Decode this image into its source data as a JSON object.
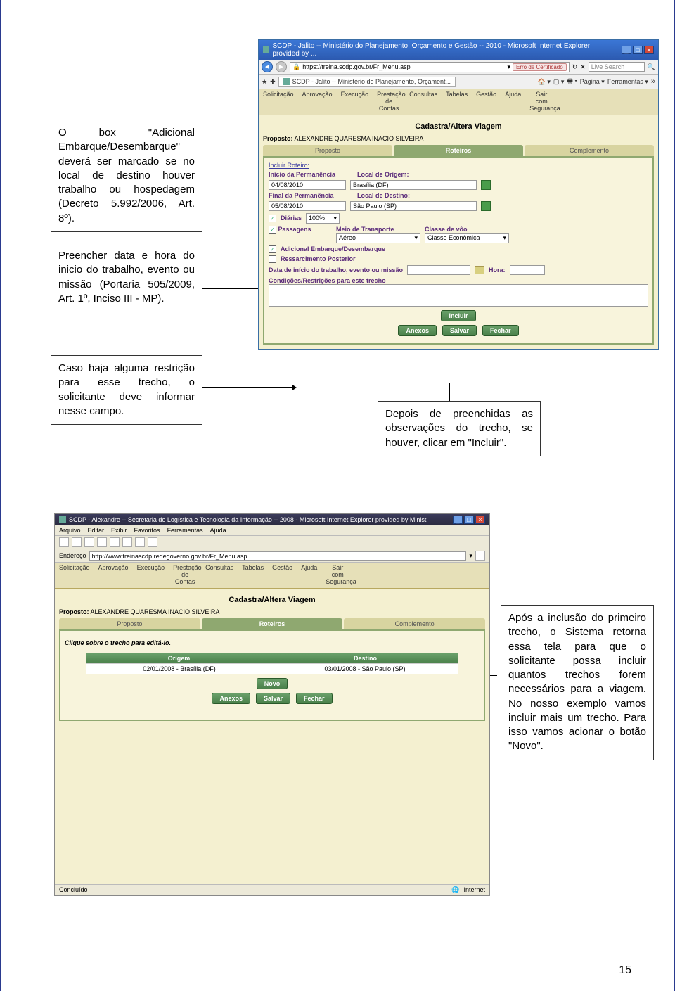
{
  "callouts": {
    "c1": "O box \"Adicional Embarque/Desembarque\" deverá ser marcado se no local de destino houver trabalho ou hospedagem (Decreto 5.992/2006, Art. 8º).",
    "c2": "Preencher data e hora do inicio do trabalho, evento ou missão (Portaria 505/2009, Art. 1º, Inciso III - MP).",
    "c3": "Caso haja alguma restrição para esse trecho, o solicitante deve informar nesse campo.",
    "c4": "Depois de preenchidas as observações do trecho, se houver, clicar em \"Incluir\".",
    "c5": "Após a inclusão do primeiro trecho, o Sistema retorna essa tela para que o solicitante possa incluir quantos trechos forem necessários para a viagem. No nosso exemplo vamos incluir mais um trecho. Para isso vamos acionar o botão \"Novo\"."
  },
  "win1": {
    "title": "SCDP - Jalito -- Ministério do Planejamento, Orçamento e Gestão -- 2010 - Microsoft Internet Explorer provided by ...",
    "url": "https://treina.scdp.gov.br/Fr_Menu.asp",
    "cert": "Erro de Certificado",
    "search_placeholder": "Live Search",
    "tab": "SCDP - Jalito -- Ministério do Planejamento, Orçament...",
    "tool_pagina": "Página",
    "tool_ferramentas": "Ferramentas",
    "menu": [
      "Solicitação",
      "Aprovação",
      "Execução",
      "Prestação de Contas",
      "Consultas",
      "Tabelas",
      "Gestão",
      "Ajuda",
      "Sair com Segurança"
    ],
    "page_title": "Cadastra/Altera Viagem",
    "proposto_label": "Proposto:",
    "proposto_value": "ALEXANDRE QUARESMA INACIO SILVEIRA",
    "tabs": [
      "Proposto",
      "Roteiros",
      "Complemento"
    ],
    "incluir_roteiro": "Incluir Roteiro:",
    "lbl_inicio_perm": "Início da Permanência",
    "lbl_local_origem": "Local de Origem:",
    "val_inicio_perm": "04/08/2010",
    "val_local_origem": "Brasília (DF)",
    "lbl_final_perm": "Final da Permanência",
    "lbl_local_destino": "Local de Destino:",
    "val_final_perm": "05/08/2010",
    "val_local_destino": "São Paulo (SP)",
    "chk_diarias": "Diárias",
    "val_diarias_pct": "100%",
    "chk_passagens": "Passagens",
    "lbl_meio_transp": "Meio de Transporte",
    "val_meio_transp": "Aéreo",
    "lbl_classe_voo": "Classe de vôo",
    "val_classe_voo": "Classe Econômica",
    "chk_adicional": "Adicional Embarque/Desembarque",
    "chk_ressarc": "Ressarcimento Posterior",
    "lbl_data_inicio_trab": "Data de início do trabalho, evento ou missão",
    "lbl_hora": "Hora:",
    "lbl_condicoes": "Condições/Restrições para este trecho",
    "btn_incluir": "Incluir",
    "btn_anexos": "Anexos",
    "btn_salvar": "Salvar",
    "btn_fechar": "Fechar"
  },
  "win2": {
    "title": "SCDP - Alexandre -- Secretaria de Logística e Tecnologia da Informação -- 2008 - Microsoft Internet Explorer provided by Minist",
    "menu_ie": [
      "Arquivo",
      "Editar",
      "Exibir",
      "Favoritos",
      "Ferramentas",
      "Ajuda"
    ],
    "addr_label": "Endereço",
    "url": "http://www.treinascdp.redegoverno.gov.br/Fr_Menu.asp",
    "menu_app": [
      "Solicitação",
      "Aprovação",
      "Execução",
      "Prestação de Contas",
      "Consultas",
      "Tabelas",
      "Gestão",
      "Ajuda",
      "Sair com Segurança"
    ],
    "page_title": "Cadastra/Altera Viagem",
    "proposto_label": "Proposto:",
    "proposto_value": "ALEXANDRE QUARESMA INACIO SILVEIRA",
    "tabs": [
      "Proposto",
      "Roteiros",
      "Complemento"
    ],
    "hint": "Clique sobre o trecho para editá-lo.",
    "col_origem": "Origem",
    "col_destino": "Destino",
    "row_origem": "02/01/2008 - Brasília (DF)",
    "row_destino": "03/01/2008 - São Paulo (SP)",
    "btn_novo": "Novo",
    "btn_anexos": "Anexos",
    "btn_salvar": "Salvar",
    "btn_fechar": "Fechar",
    "status_left": "Concluído",
    "status_right": "Internet"
  },
  "page_number": "15"
}
